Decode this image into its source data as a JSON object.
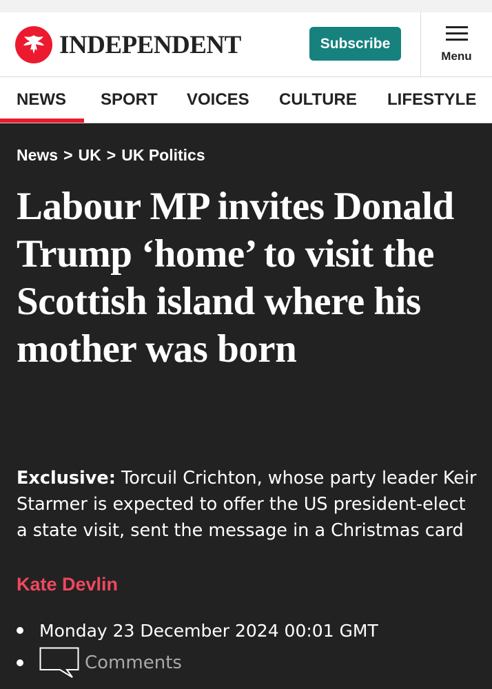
{
  "header": {
    "logo_text": "INDEPENDENT",
    "subscribe_label": "Subscribe",
    "menu_label": "Menu"
  },
  "nav": {
    "items": [
      {
        "label": "NEWS",
        "active": true
      },
      {
        "label": "SPORT",
        "active": false
      },
      {
        "label": "VOICES",
        "active": false
      },
      {
        "label": "CULTURE",
        "active": false
      },
      {
        "label": "LIFESTYLE",
        "active": false
      }
    ]
  },
  "breadcrumb": {
    "items": [
      "News",
      "UK",
      "UK Politics"
    ],
    "separator": ">"
  },
  "article": {
    "headline": "Labour MP invites Donald Trump ‘home’ to visit the Scottish island where his mother was born",
    "standfirst_label": "Exclusive:",
    "standfirst_text": " Torcuil Crichton, whose party leader Keir Starmer is expected to offer the US president-elect a state visit, sent the message in a Christmas card",
    "author": "Kate Devlin",
    "date": "Monday 23 December 2024 00:01 GMT",
    "comments_label": "Comments"
  },
  "colors": {
    "brand_red": "#ec1a2e",
    "subscribe_teal": "#17817e",
    "author_red": "#f0485d",
    "background": "#222222"
  },
  "icons": {
    "logo": "eagle-icon",
    "menu": "hamburger-icon",
    "comments": "speech-bubble-icon"
  }
}
